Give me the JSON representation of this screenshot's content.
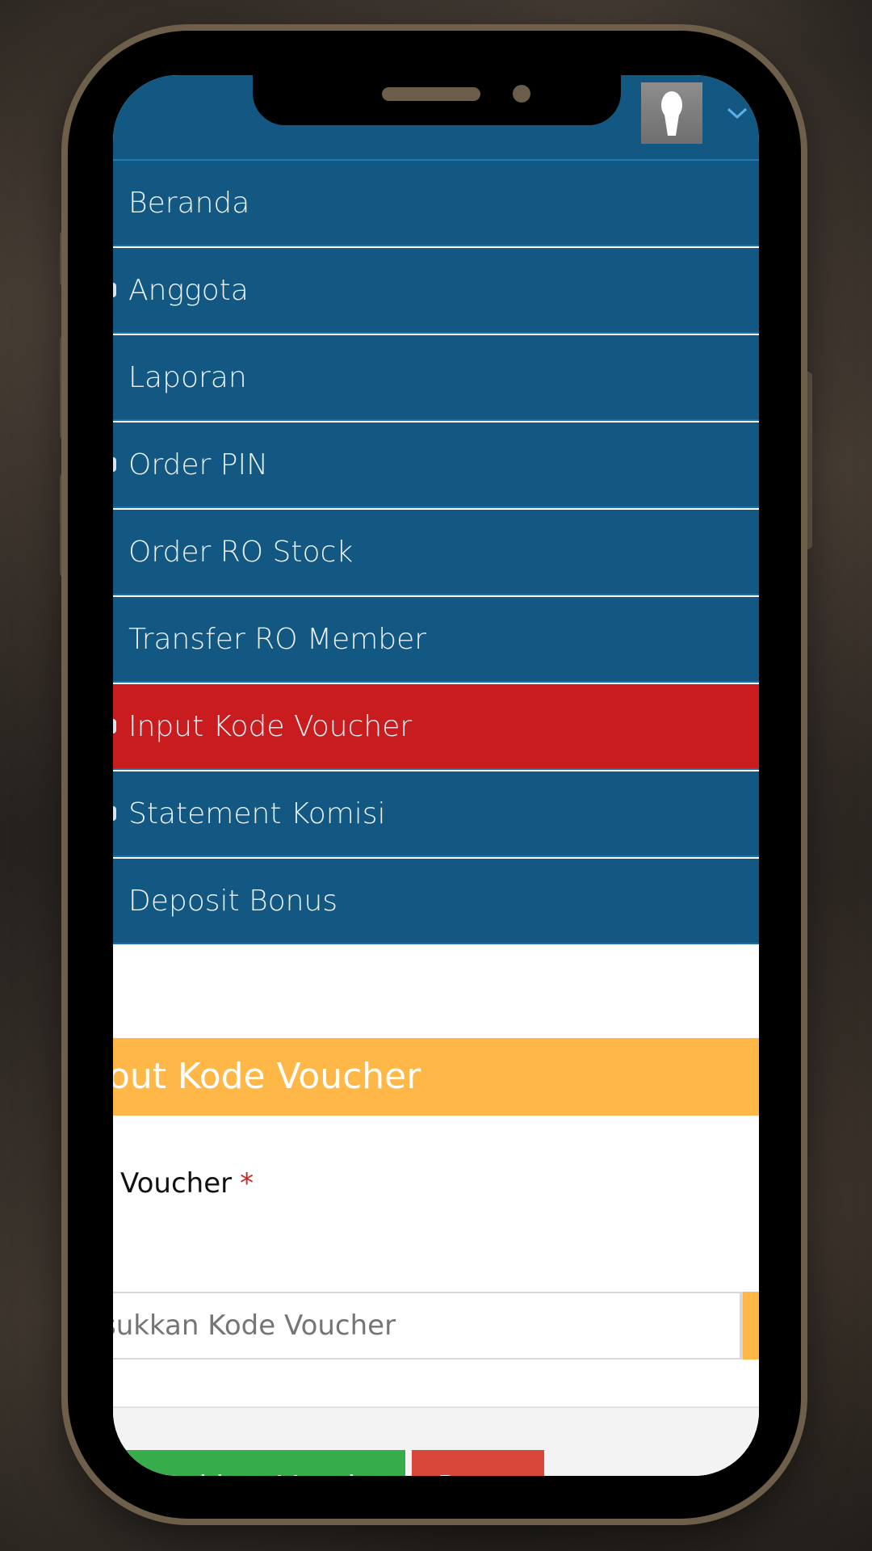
{
  "colors": {
    "header_bg": "#135883",
    "active_item_bg": "#c91c1e",
    "panel_head_bg": "#ffb748",
    "primary_button": "#36ad4a",
    "reset_button": "#d9473b"
  },
  "header": {
    "avatar_icon": "user-silhouette-icon",
    "dropdown_icon": "chevron-down-icon"
  },
  "menu": {
    "items": [
      {
        "label": "Beranda"
      },
      {
        "label": "Anggota"
      },
      {
        "label": "Laporan"
      },
      {
        "label": "Order PIN"
      },
      {
        "label": "Order RO Stock"
      },
      {
        "label": "Transfer RO Member"
      },
      {
        "label": "Input Kode Voucher",
        "active": true
      },
      {
        "label": "Statement Komisi"
      },
      {
        "label": "Deposit Bonus"
      }
    ]
  },
  "form": {
    "title": "out Kode Voucher",
    "field_label": "Voucher",
    "required_mark": "*",
    "input_placeholder": "sukkan Kode Voucher",
    "submit_label": "Masukkan Voucher",
    "reset_label": "Reset"
  }
}
